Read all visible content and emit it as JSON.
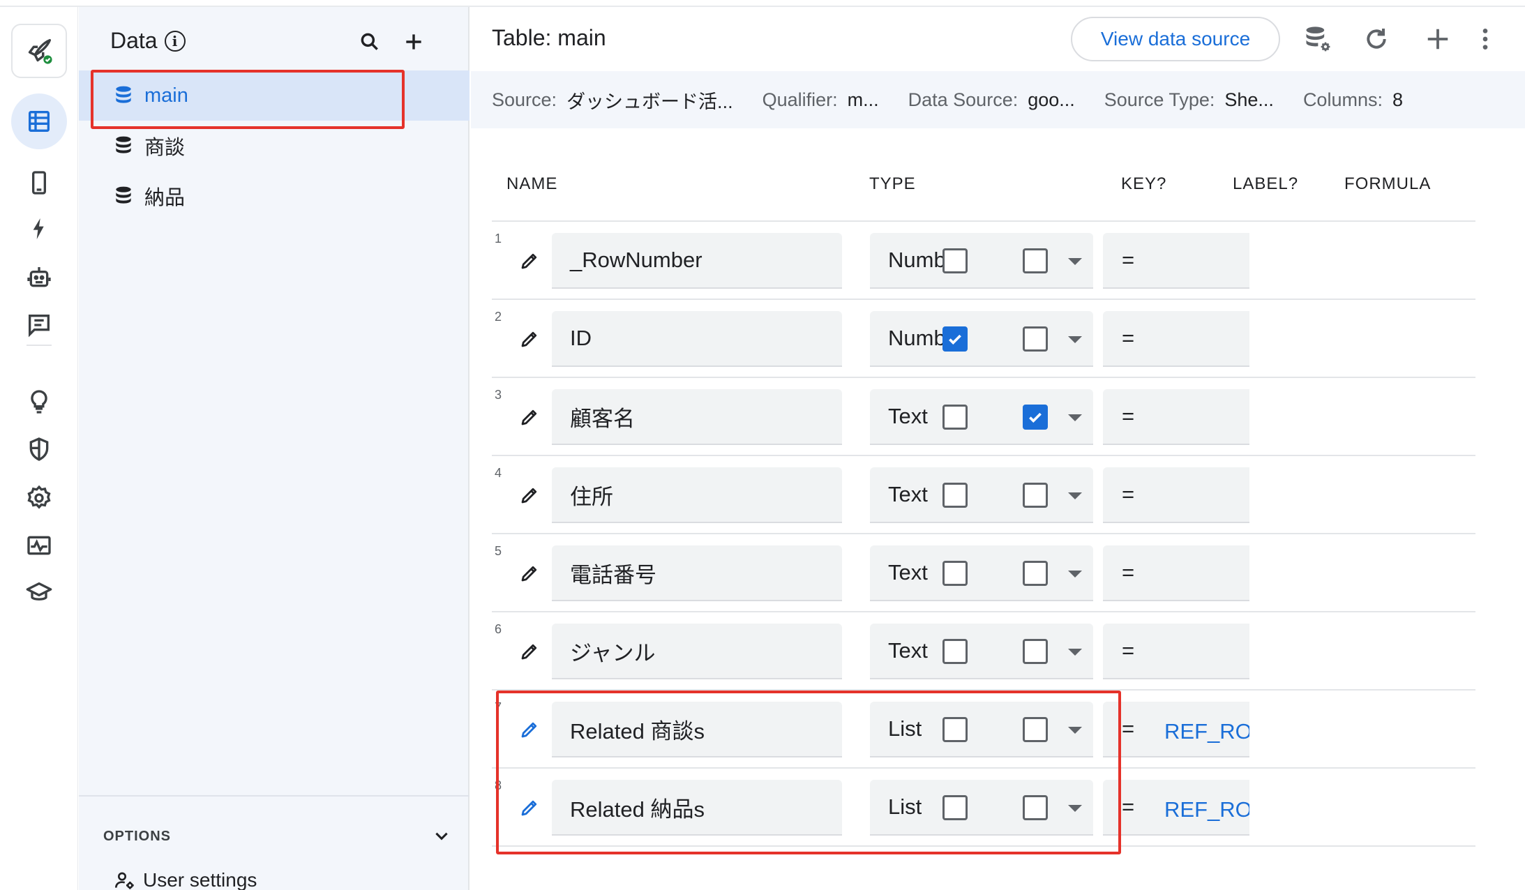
{
  "panel": {
    "title": "Data",
    "tables": [
      {
        "label": "main",
        "selected": true
      },
      {
        "label": "商談",
        "selected": false
      },
      {
        "label": "納品",
        "selected": false
      }
    ],
    "options_label": "OPTIONS",
    "user_settings_label": "User settings"
  },
  "main": {
    "title": "Table: main",
    "view_source_label": "View data source",
    "info": {
      "source_label": "Source:",
      "source_value": "ダッシュボード活...",
      "qualifier_label": "Qualifier:",
      "qualifier_value": "m...",
      "datasource_label": "Data Source:",
      "datasource_value": "goo...",
      "sourcetype_label": "Source Type:",
      "sourcetype_value": "She...",
      "columns_label": "Columns:",
      "columns_value": "8"
    },
    "headers": {
      "name": "NAME",
      "type": "TYPE",
      "key": "KEY?",
      "label": "LABEL?",
      "formula": "FORMULA"
    },
    "columns": [
      {
        "num": "1",
        "name": "_RowNumber",
        "type": "Number",
        "key": false,
        "label": false,
        "formula_eq": "=",
        "formula": ""
      },
      {
        "num": "2",
        "name": "ID",
        "type": "Number",
        "key": true,
        "label": false,
        "formula_eq": "=",
        "formula": ""
      },
      {
        "num": "3",
        "name": "顧客名",
        "type": "Text",
        "key": false,
        "label": true,
        "formula_eq": "=",
        "formula": ""
      },
      {
        "num": "4",
        "name": "住所",
        "type": "Text",
        "key": false,
        "label": false,
        "formula_eq": "=",
        "formula": ""
      },
      {
        "num": "5",
        "name": "電話番号",
        "type": "Text",
        "key": false,
        "label": false,
        "formula_eq": "=",
        "formula": ""
      },
      {
        "num": "6",
        "name": "ジャンル",
        "type": "Text",
        "key": false,
        "label": false,
        "formula_eq": "=",
        "formula": ""
      },
      {
        "num": "7",
        "name": "Related 商談s",
        "type": "List",
        "key": false,
        "label": false,
        "formula_eq": "=",
        "formula": "REF_ROWS(\"商談\", \"顧客\")"
      },
      {
        "num": "8",
        "name": "Related 納品s",
        "type": "List",
        "key": false,
        "label": false,
        "formula_eq": "=",
        "formula": "REF_ROWS(\"納品\", \"顧客\")"
      }
    ]
  },
  "colors": {
    "accent": "#1a6ed8",
    "highlight": "#e5322a",
    "panel_bg": "#f3f6fb",
    "selected_bg": "#d9e5f8"
  },
  "icons": {
    "rail": [
      "rocket-icon",
      "table-icon",
      "phone-icon",
      "bolt-icon",
      "bot-icon",
      "chat-icon",
      "bulb-icon",
      "shield-icon",
      "gear-icon",
      "monitor-icon",
      "graduation-cap-icon"
    ],
    "toolbar": [
      "database-settings-icon",
      "refresh-icon",
      "add-icon",
      "more-vert-icon"
    ]
  }
}
